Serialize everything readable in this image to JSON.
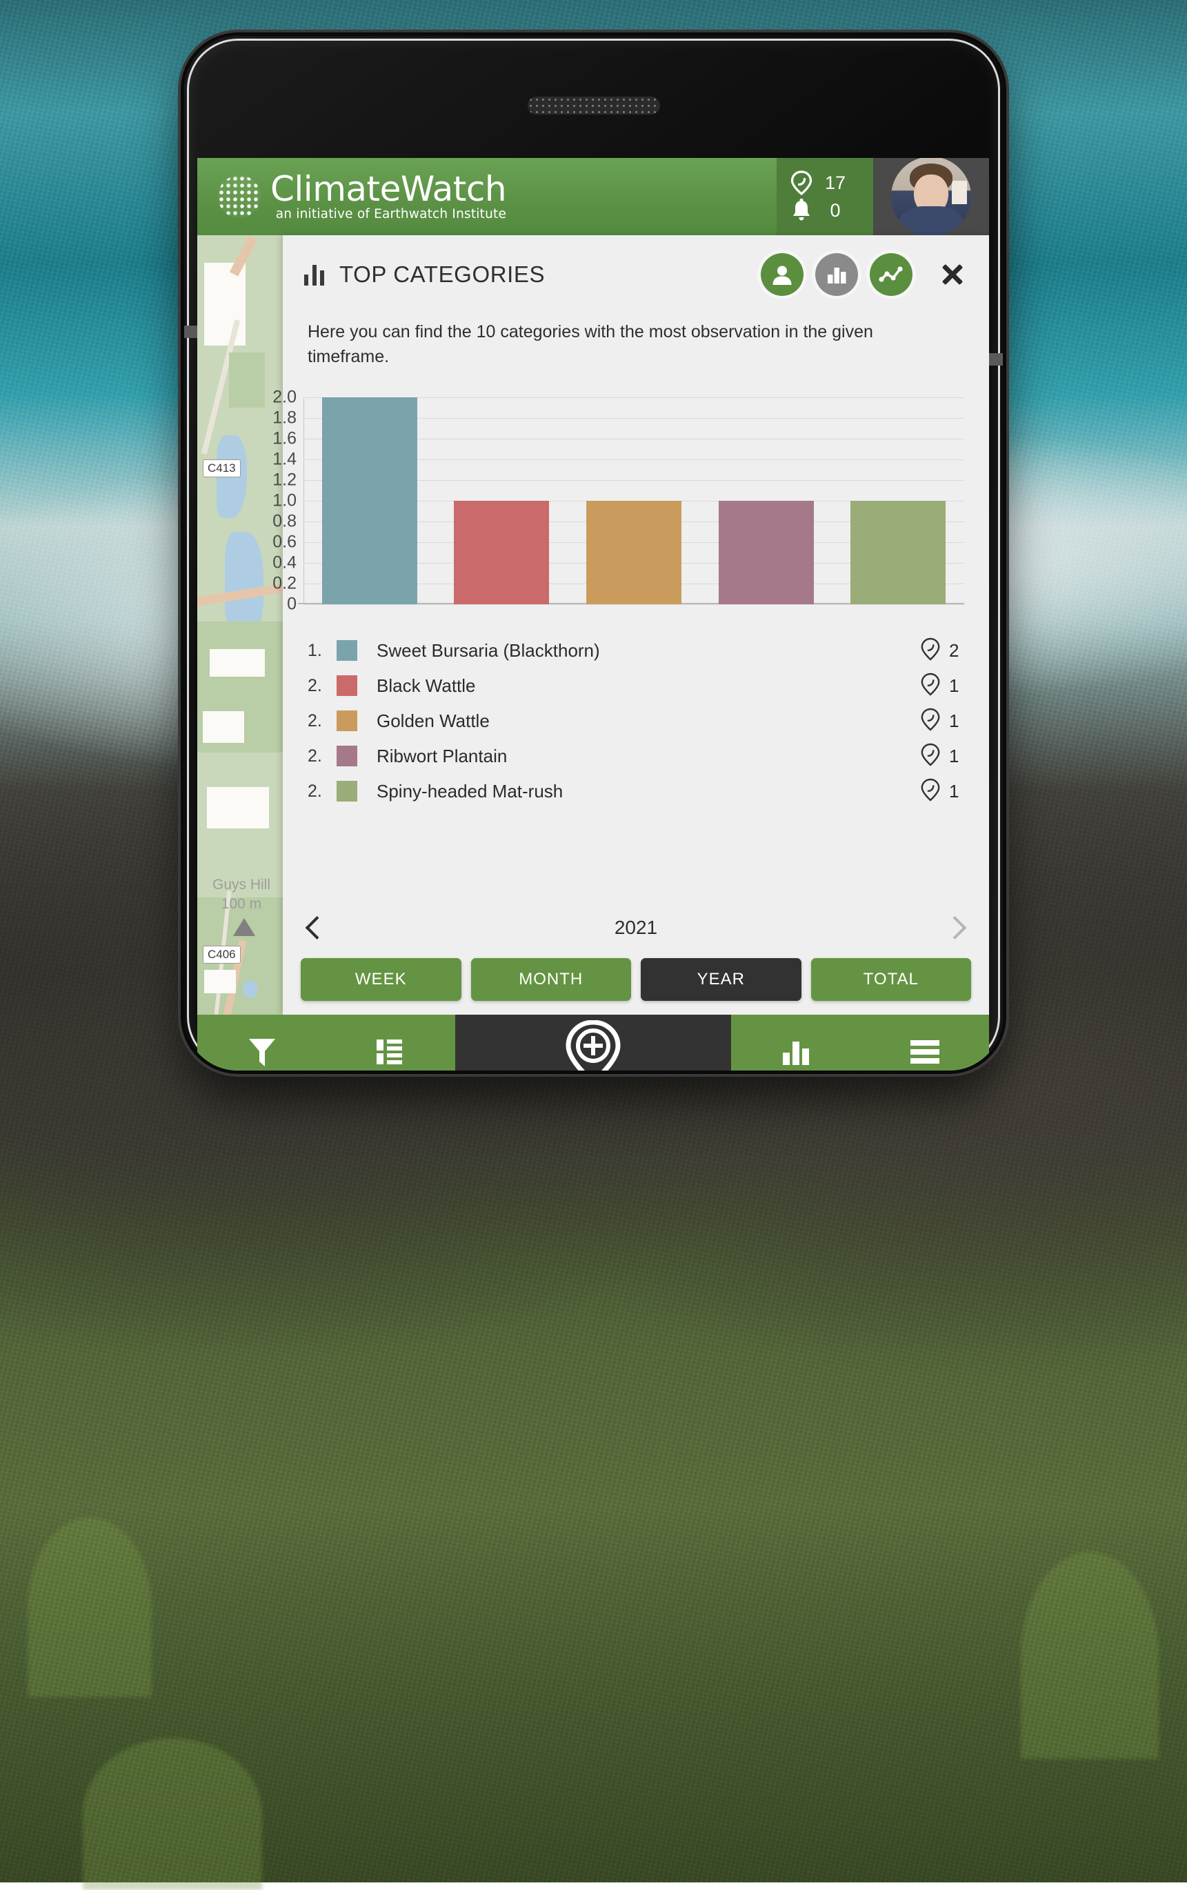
{
  "app": {
    "brand_name": "ClimateWatch",
    "brand_tagline": "an initiative of Earthwatch Institute",
    "brand_green": "#5b9144",
    "observations_count": "17",
    "notifications_count": "0",
    "observations_icon": "pin-icon",
    "notifications_icon": "bell-icon",
    "avatar_icon": "user-avatar"
  },
  "panel": {
    "title": "TOP CATEGORIES",
    "title_icon": "bar-chart-icon",
    "description": "Here you can find the 10 categories with the most observation in the given timeframe.",
    "actions": [
      {
        "name": "profile-stats-button",
        "icon": "person-icon",
        "color": "#5b8f3f",
        "active": false
      },
      {
        "name": "bar-chart-stats-button",
        "icon": "bar-chart-icon",
        "color": "#8a8a8a",
        "active": true
      },
      {
        "name": "line-chart-stats-button",
        "icon": "line-chart-icon",
        "color": "#5b8f3f",
        "active": false
      }
    ],
    "close_icon": "close-icon"
  },
  "chart_data": {
    "type": "bar",
    "title": "TOP CATEGORIES",
    "xlabel": "",
    "ylabel": "",
    "ylim": [
      0,
      2.0
    ],
    "grid": true,
    "legend_position": "below",
    "yticks": [
      "2.0",
      "1.8",
      "1.6",
      "1.4",
      "1.2",
      "1.0",
      "0.8",
      "0.6",
      "0.4",
      "0.2",
      "0"
    ],
    "ytick_values": [
      2.0,
      1.8,
      1.6,
      1.4,
      1.2,
      1.0,
      0.8,
      0.6,
      0.4,
      0.2,
      0
    ],
    "categories": [
      "Sweet Bursaria (Blackthorn)",
      "Black Wattle",
      "Golden Wattle",
      "Ribwort Plantain",
      "Spiny-headed Mat-rush"
    ],
    "values": [
      2,
      1,
      1,
      1,
      1
    ],
    "colors": [
      "#7ba3ac",
      "#cb6a6a",
      "#c99c5d",
      "#a5788a",
      "#9aac77"
    ]
  },
  "legend": {
    "count_icon": "pin-icon",
    "items": [
      {
        "rank": "1.",
        "color": "#7ba3ac",
        "label": "Sweet Bursaria (Blackthorn)",
        "count": "2"
      },
      {
        "rank": "2.",
        "color": "#cb6a6a",
        "label": "Black Wattle",
        "count": "1"
      },
      {
        "rank": "2.",
        "color": "#c99c5d",
        "label": "Golden Wattle",
        "count": "1"
      },
      {
        "rank": "2.",
        "color": "#a5788a",
        "label": "Ribwort Plantain",
        "count": "1"
      },
      {
        "rank": "2.",
        "color": "#9aac77",
        "label": "Spiny-headed Mat-rush",
        "count": "1"
      }
    ]
  },
  "period": {
    "prev_icon": "chevron-left-icon",
    "next_icon": "chevron-right-icon",
    "current_label": "2021",
    "buttons": [
      {
        "label": "WEEK",
        "active": false
      },
      {
        "label": "MONTH",
        "active": false
      },
      {
        "label": "YEAR",
        "active": true
      },
      {
        "label": "TOTAL",
        "active": false
      }
    ]
  },
  "bottom_nav": {
    "items": [
      {
        "name": "filter-icon",
        "label": "filter"
      },
      {
        "name": "list-icon",
        "label": "list"
      },
      {
        "name": "add-observation-icon",
        "label": "add"
      },
      {
        "name": "bar-chart-icon",
        "label": "stats"
      },
      {
        "name": "menu-icon",
        "label": "menu"
      }
    ]
  },
  "map": {
    "labels": [
      {
        "text": "C413"
      },
      {
        "text": "C406"
      }
    ],
    "place_name": "Guys Hill",
    "place_elevation": "100 m"
  }
}
